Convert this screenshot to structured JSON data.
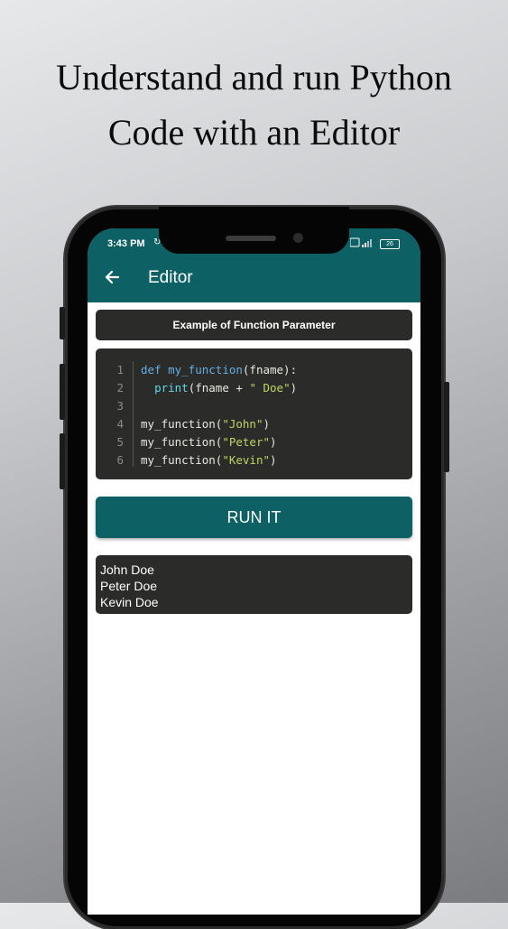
{
  "headline": {
    "line1": "Understand and run Python",
    "line2": "Code with an Editor"
  },
  "status_bar": {
    "time": "3:43 PM",
    "battery": "26"
  },
  "app_bar": {
    "title": "Editor",
    "back_icon": "arrow-left-icon"
  },
  "example": {
    "title": "Example of Function Parameter"
  },
  "code": {
    "lines": [
      {
        "number": "1",
        "parts": [
          {
            "t": "def ",
            "c": "kw"
          },
          {
            "t": "my_function",
            "c": "fn"
          },
          {
            "t": "(fname):",
            "c": ""
          }
        ]
      },
      {
        "number": "2",
        "parts": [
          {
            "t": "  ",
            "c": ""
          },
          {
            "t": "print",
            "c": "bi"
          },
          {
            "t": "(fname + ",
            "c": ""
          },
          {
            "t": "\" Doe\"",
            "c": "str"
          },
          {
            "t": ")",
            "c": ""
          }
        ]
      },
      {
        "number": "3",
        "parts": []
      },
      {
        "number": "4",
        "parts": [
          {
            "t": "my_function(",
            "c": ""
          },
          {
            "t": "\"John\"",
            "c": "str"
          },
          {
            "t": ")",
            "c": ""
          }
        ]
      },
      {
        "number": "5",
        "parts": [
          {
            "t": "my_function(",
            "c": ""
          },
          {
            "t": "\"Peter\"",
            "c": "str"
          },
          {
            "t": ")",
            "c": ""
          }
        ]
      },
      {
        "number": "6",
        "parts": [
          {
            "t": "my_function(",
            "c": ""
          },
          {
            "t": "\"Kevin\"",
            "c": "str"
          },
          {
            "t": ")",
            "c": ""
          }
        ]
      }
    ]
  },
  "run_button": {
    "label": "RUN IT"
  },
  "output": {
    "lines": [
      "John Doe",
      "Peter Doe",
      "Kevin Doe"
    ]
  },
  "colors": {
    "accent": "#0d6063",
    "panel": "#2b2b29",
    "keyword": "#66aee6",
    "string": "#b9d760"
  }
}
